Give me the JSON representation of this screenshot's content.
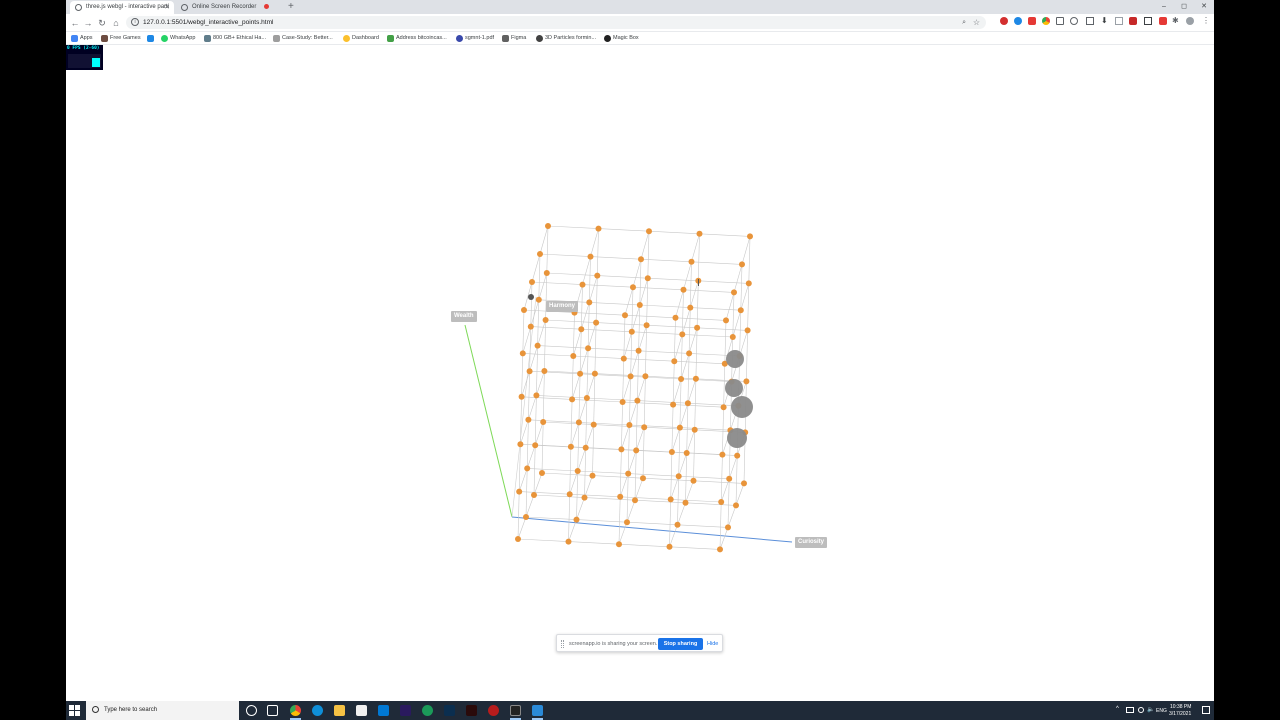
{
  "browser": {
    "tabs": [
      {
        "title": "three.js webgl - interactive parti",
        "active": true
      },
      {
        "title": "Online Screen Recorder",
        "active": false
      }
    ],
    "new_tab_label": "+",
    "window_controls": {
      "minimize": "–",
      "maximize": "◻",
      "close": "✕"
    },
    "url": "127.0.0.1:5501/webgl_interactive_points.html",
    "nav": {
      "back": "←",
      "forward": "→",
      "reload": "↻",
      "home": "⌂"
    }
  },
  "bookmarks": [
    {
      "label": "Apps",
      "color": "#4285f4"
    },
    {
      "label": "Free Games",
      "color": "#6d4c41"
    },
    {
      "label": "",
      "color": "#1e88e5"
    },
    {
      "label": "WhatsApp",
      "color": "#25d366"
    },
    {
      "label": "800 GB+ Ethical Ha...",
      "color": "#607d8b"
    },
    {
      "label": "Case-Study: Better...",
      "color": "#9e9e9e"
    },
    {
      "label": "Dashboard",
      "color": "#fbc02d"
    },
    {
      "label": "Address bitcoincas...",
      "color": "#43a047"
    },
    {
      "label": "sgmnt-1.pdf",
      "color": "#3949ab"
    },
    {
      "label": "Figma",
      "color": "#616161"
    },
    {
      "label": "3D Particles formin...",
      "color": "#424242"
    },
    {
      "label": "Magic Box",
      "color": "#212121"
    }
  ],
  "stats": {
    "fps_label": "0 FPS (2-60)"
  },
  "scene": {
    "axis_labels": {
      "wealth": "Wealth",
      "harmony": "Harmony",
      "curiosity": "Curiosity"
    },
    "point_color": "#e8943a",
    "grid_color": "#c8c8c8",
    "big_point_color": "#8a8a8a",
    "axis_colors": {
      "wealth": "#7ed957",
      "curiosity": "#5b8fd9"
    }
  },
  "share_bar": {
    "message": "screenapp.io is sharing your screen.",
    "stop_label": "Stop sharing",
    "hide_label": "Hide"
  },
  "taskbar": {
    "search_placeholder": "Type here to search",
    "language": "ENG",
    "time": "10:38 PM",
    "date": "3/17/2021"
  }
}
